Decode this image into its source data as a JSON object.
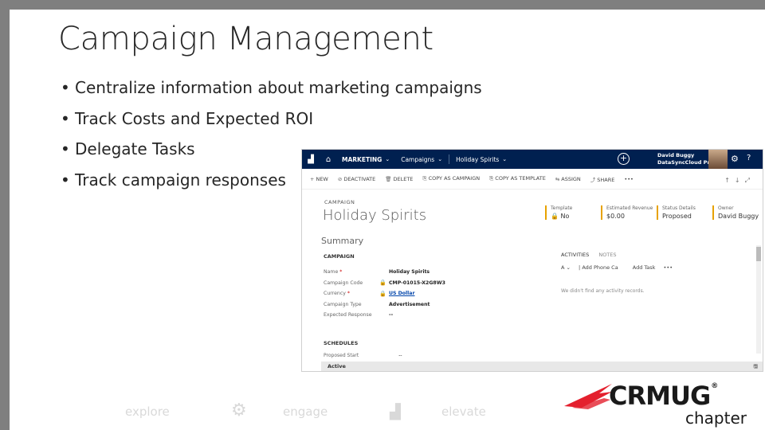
{
  "slide": {
    "title": "Campaign Management",
    "bullets": [
      "Centralize information about marketing campaigns",
      "Track Costs and Expected ROI",
      "Delegate Tasks",
      "Track campaign responses"
    ]
  },
  "crm": {
    "nav": {
      "area": "MARKETING",
      "entity": "Campaigns",
      "record": "Holiday Spirits",
      "user_name": "David Buggy",
      "user_org": "DataSyncCloud Pr..."
    },
    "commands": [
      {
        "icon": "+",
        "label": "NEW"
      },
      {
        "icon": "⊘",
        "label": "DEACTIVATE"
      },
      {
        "icon": "🗑",
        "label": "DELETE"
      },
      {
        "icon": "⎘",
        "label": "COPY AS CAMPAIGN"
      },
      {
        "icon": "⎘",
        "label": "COPY AS TEMPLATE"
      },
      {
        "icon": "⇆",
        "label": "ASSIGN"
      },
      {
        "icon": "⤴",
        "label": "SHARE"
      },
      {
        "icon": "",
        "label": "•••"
      }
    ],
    "entity_type": "CAMPAIGN",
    "record_name": "Holiday Spirits",
    "header_fields": [
      {
        "label": "Template",
        "value": "No"
      },
      {
        "label": "Estimated Revenue",
        "value": "$0.00"
      },
      {
        "label": "Status Details",
        "value": "Proposed"
      },
      {
        "label": "Owner",
        "value": "David Buggy"
      }
    ],
    "summary": "Summary",
    "section_campaign": "CAMPAIGN",
    "fields": [
      {
        "label": "Name",
        "value": "Holiday Spirits",
        "required": true,
        "locked": false,
        "link": false
      },
      {
        "label": "Campaign Code",
        "value": "CMP-01015-X2G8W3",
        "required": false,
        "locked": true,
        "link": false
      },
      {
        "label": "Currency",
        "value": "US Dollar",
        "required": true,
        "locked": true,
        "link": true
      },
      {
        "label": "Campaign Type",
        "value": "Advertisement",
        "required": false,
        "locked": false,
        "link": false
      },
      {
        "label": "Expected Response",
        "value": "--",
        "required": false,
        "locked": false,
        "link": false
      }
    ],
    "section_schedules": "SCHEDULES",
    "proposed_start_label": "Proposed Start",
    "proposed_start_value": "--",
    "activities_tab": "ACTIVITIES",
    "notes_tab": "NOTES",
    "add_phone": "Add Phone Ca",
    "add_task": "Add Task",
    "activities_empty": "We didn't find any activity records.",
    "status": "Active"
  },
  "footer": {
    "explore": "explore",
    "engage": "engage",
    "elevate": "elevate"
  },
  "logo": {
    "text": "CRMUG",
    "sub": "chapter"
  },
  "colors": {
    "nav_bg": "#002050",
    "accent_orange": "#e7a200",
    "logo_red": "#e4202e"
  }
}
